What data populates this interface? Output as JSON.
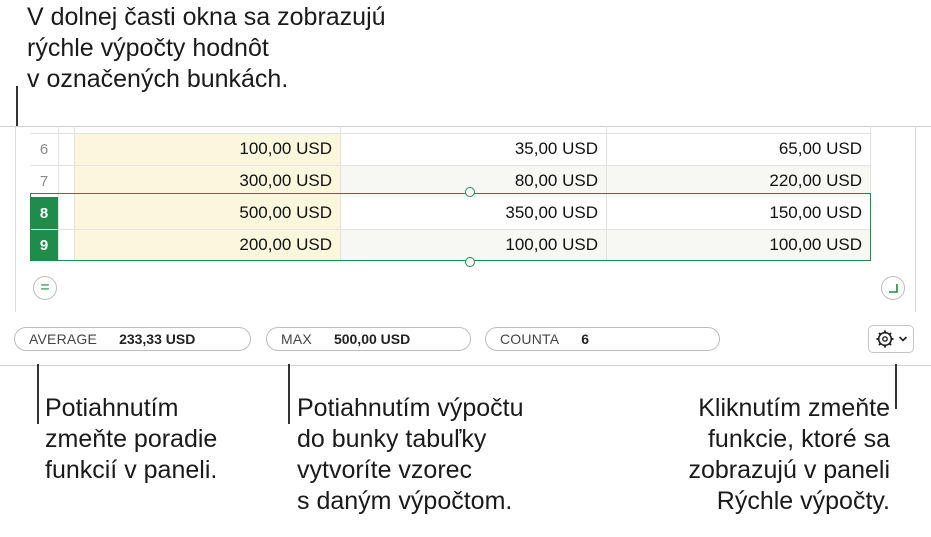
{
  "callouts": {
    "top": [
      "V dolnej časti okna sa zobrazujú",
      "rýchle výpočty hodnôt",
      "v označených bunkách."
    ],
    "left": [
      "Potiahnutím",
      "zmeňte poradie",
      "funkcií v paneli."
    ],
    "middle": [
      "Potiahnutím výpočtu",
      "do bunky tabuľky",
      "vytvoríte vzorec",
      "s daným výpočtom."
    ],
    "right": [
      "Kliknutím zmeňte",
      "funkcie, ktoré sa",
      "zobrazujú v paneli",
      "Rýchle výpočty."
    ]
  },
  "table": {
    "rows": [
      {
        "num": "6",
        "c1": "100,00 USD",
        "c2": "35,00 USD",
        "c3": "65,00 USD",
        "selected": false
      },
      {
        "num": "7",
        "c1": "300,00 USD",
        "c2": "80,00 USD",
        "c3": "220,00 USD",
        "selected": false
      },
      {
        "num": "8",
        "c1": "500,00 USD",
        "c2": "350,00 USD",
        "c3": "150,00 USD",
        "selected": true
      },
      {
        "num": "9",
        "c1": "200,00 USD",
        "c2": "100,00 USD",
        "c3": "100,00 USD",
        "selected": true
      }
    ]
  },
  "quick_calc": {
    "average": {
      "label": "AVERAGE",
      "value": "233,33 USD"
    },
    "max": {
      "label": "MAX",
      "value": "500,00 USD"
    },
    "counta": {
      "label": "COUNTA",
      "value": "6"
    }
  },
  "colors": {
    "selection": "#1e8c4a",
    "highlight_column": "#fbf7dc"
  }
}
